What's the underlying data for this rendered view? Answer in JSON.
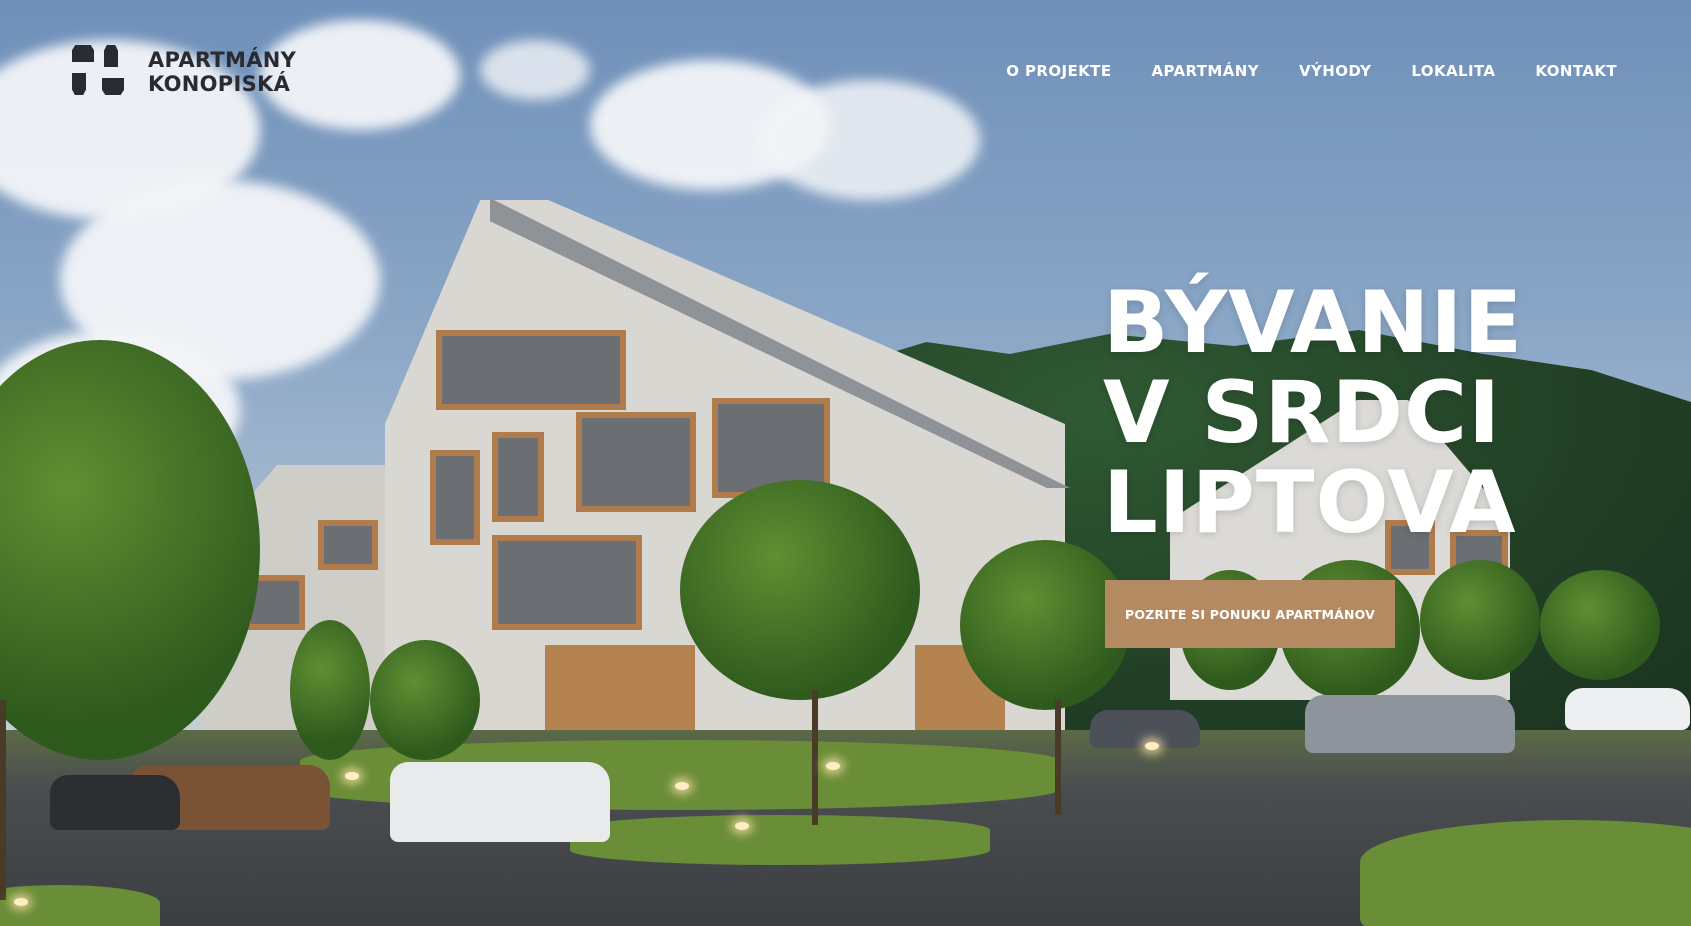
{
  "brand": {
    "logo_line1": "APARTMÁNY",
    "logo_line2": "KONOPISKÁ",
    "color_dark": "#2a2a33"
  },
  "nav": {
    "items": [
      {
        "label": "O PROJEKTE"
      },
      {
        "label": "APARTMÁNY"
      },
      {
        "label": "VÝHODY"
      },
      {
        "label": "LOKALITA"
      },
      {
        "label": "KONTAKT"
      }
    ]
  },
  "hero": {
    "headline_line1": "BÝVANIE",
    "headline_line2": "V SRDCI",
    "headline_line3": "LIPTOVA",
    "cta_label": "POZRITE SI PONUKU APARTMÁNOV",
    "cta_color": "#b48a62",
    "background": "architectural-render-apartment-buildings-forest"
  }
}
